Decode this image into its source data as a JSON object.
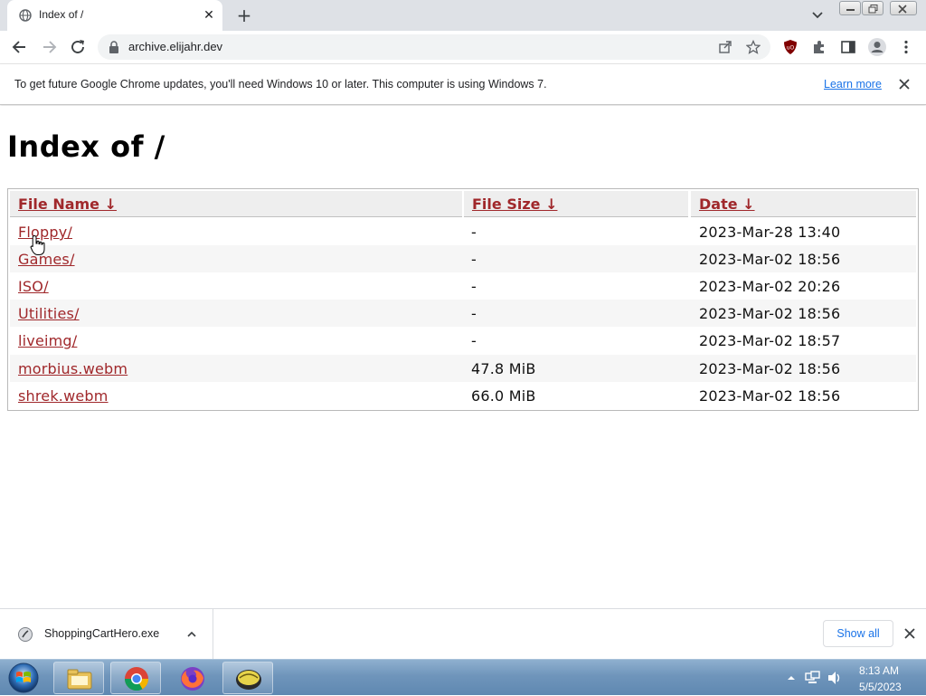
{
  "tab": {
    "title": "Index of /"
  },
  "toolbar": {
    "url": "archive.elijahr.dev"
  },
  "infobar": {
    "message": "To get future Google Chrome updates, you'll need Windows 10 or later. This computer is using Windows 7.",
    "link": "Learn more"
  },
  "page": {
    "heading": "Index of /",
    "columns": [
      "File Name ↓",
      "File Size ↓",
      "Date ↓"
    ],
    "rows": [
      {
        "name": "Floppy/",
        "size": "-",
        "date": "2023-Mar-28 13:40"
      },
      {
        "name": "Games/",
        "size": "-",
        "date": "2023-Mar-02 18:56"
      },
      {
        "name": "ISO/",
        "size": "-",
        "date": "2023-Mar-02 20:26"
      },
      {
        "name": "Utilities/",
        "size": "-",
        "date": "2023-Mar-02 18:56"
      },
      {
        "name": "liveimg/",
        "size": "-",
        "date": "2023-Mar-02 18:57"
      },
      {
        "name": "morbius.webm",
        "size": "47.8 MiB",
        "date": "2023-Mar-02 18:56"
      },
      {
        "name": "shrek.webm",
        "size": "66.0 MiB",
        "date": "2023-Mar-02 18:56"
      }
    ]
  },
  "downloads": {
    "file": "ShoppingCartHero.exe",
    "show_all": "Show all"
  },
  "taskbar": {
    "time": "8:13 AM",
    "date": "5/5/2023"
  },
  "colors": {
    "link": "#a0282b",
    "chrome_accent": "#1a73e8",
    "taskbar": "#6f95bb"
  },
  "icons": [
    "globe-icon",
    "close-icon",
    "plus-icon",
    "chevron-down-icon",
    "back-icon",
    "forward-icon",
    "reload-icon",
    "lock-icon",
    "share-icon",
    "star-icon",
    "ublock-icon",
    "extensions-icon",
    "sidepanel-icon",
    "profile-icon",
    "menu-icon",
    "download-file-icon",
    "start-orb-icon",
    "explorer-icon",
    "chrome-icon",
    "firefox-icon",
    "app-icon",
    "network-icon",
    "volume-icon"
  ]
}
